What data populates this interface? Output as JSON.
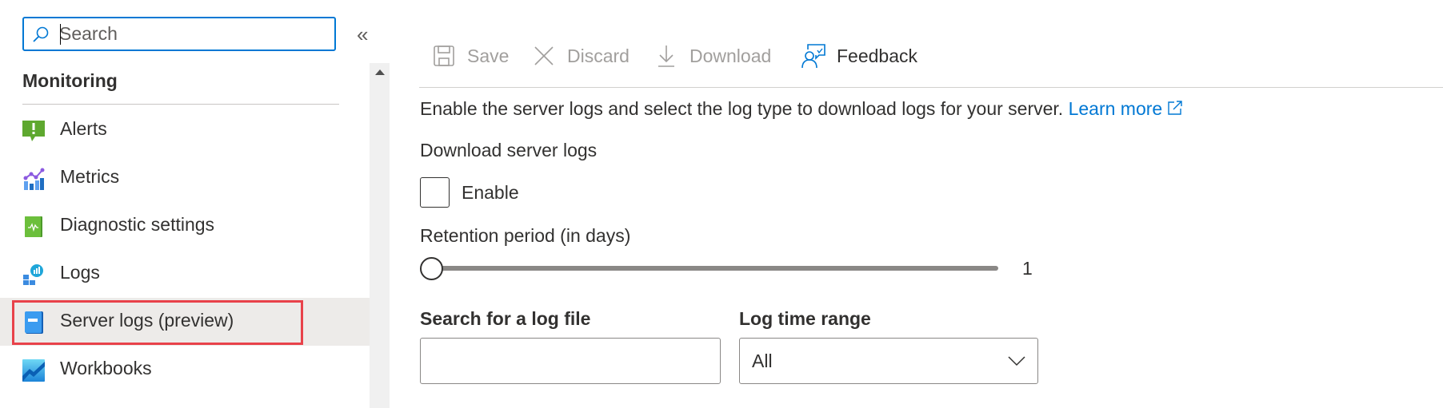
{
  "sidebar": {
    "search": {
      "placeholder": "Search",
      "value": ""
    },
    "collapse_glyph": "«",
    "section_title": "Monitoring",
    "items": [
      {
        "label": "Alerts",
        "icon": "alerts-icon",
        "selected": false
      },
      {
        "label": "Metrics",
        "icon": "metrics-icon",
        "selected": false
      },
      {
        "label": "Diagnostic settings",
        "icon": "diagnostic-settings-icon",
        "selected": false
      },
      {
        "label": "Logs",
        "icon": "logs-icon",
        "selected": false
      },
      {
        "label": "Server logs (preview)",
        "icon": "server-logs-icon",
        "selected": true
      },
      {
        "label": "Workbooks",
        "icon": "workbooks-icon",
        "selected": false
      }
    ]
  },
  "toolbar": {
    "save_label": "Save",
    "discard_label": "Discard",
    "download_label": "Download",
    "feedback_label": "Feedback"
  },
  "content": {
    "description": "Enable the server logs and select the log type to download logs for your server.",
    "learn_more": "Learn more",
    "download_section_label": "Download server logs",
    "enable_label": "Enable",
    "enable_checked": false,
    "retention_label": "Retention period (in days)",
    "retention_value": "1",
    "retention_fraction": 0,
    "search_log_label": "Search for a log file",
    "search_log_value": "",
    "time_range_label": "Log time range",
    "time_range_value": "All"
  },
  "colors": {
    "accent": "#0078d4",
    "selected_bg": "#edebe9",
    "highlight_border": "#e8424a",
    "disabled_text": "#a19f9d"
  }
}
